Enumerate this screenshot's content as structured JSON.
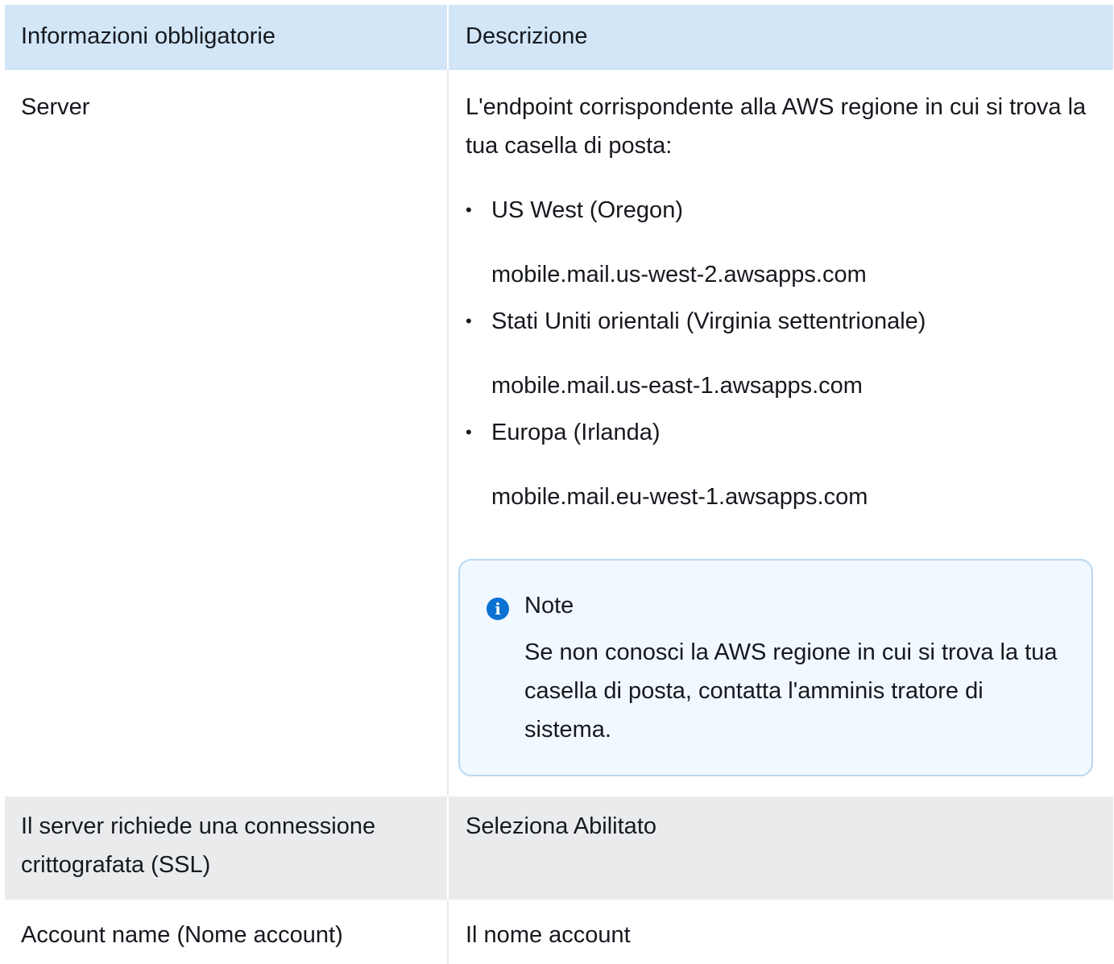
{
  "table": {
    "headers": [
      "Informazioni obbligatorie",
      "Descrizione"
    ],
    "server": {
      "label": "Server",
      "intro": "L'endpoint corrispondente alla AWS regione in cui si trova la tua casella di posta:",
      "regions": [
        {
          "name": "US West (Oregon)",
          "endpoint": "mobile.mail.us-west-2.awsapps.com"
        },
        {
          "name": "Stati Uniti orientali (Virginia settentrionale)",
          "endpoint": "mobile.mail.us-east-1.awsapps.com"
        },
        {
          "name": "Europa (Irlanda)",
          "endpoint": "mobile.mail.eu-west-1.awsapps.com"
        }
      ],
      "note": {
        "icon": "info-icon",
        "title": "Note",
        "body": "Se non conosci la AWS regione in cui si trova la tua casella di posta, contatta l'amminis tratore di sistema."
      }
    },
    "ssl": {
      "label": "Il server richiede una connessione crittografata (SSL)",
      "description": "Seleziona Abilitato"
    },
    "account": {
      "label": "Account name (Nome account)",
      "description": "Il nome account"
    }
  },
  "colors": {
    "header_bg": "#d2e6f7",
    "stripe_bg": "#e9ebed",
    "note_bg": "#f1f8ff",
    "note_border": "#b8d8f3",
    "info_icon": "#0972d3"
  }
}
